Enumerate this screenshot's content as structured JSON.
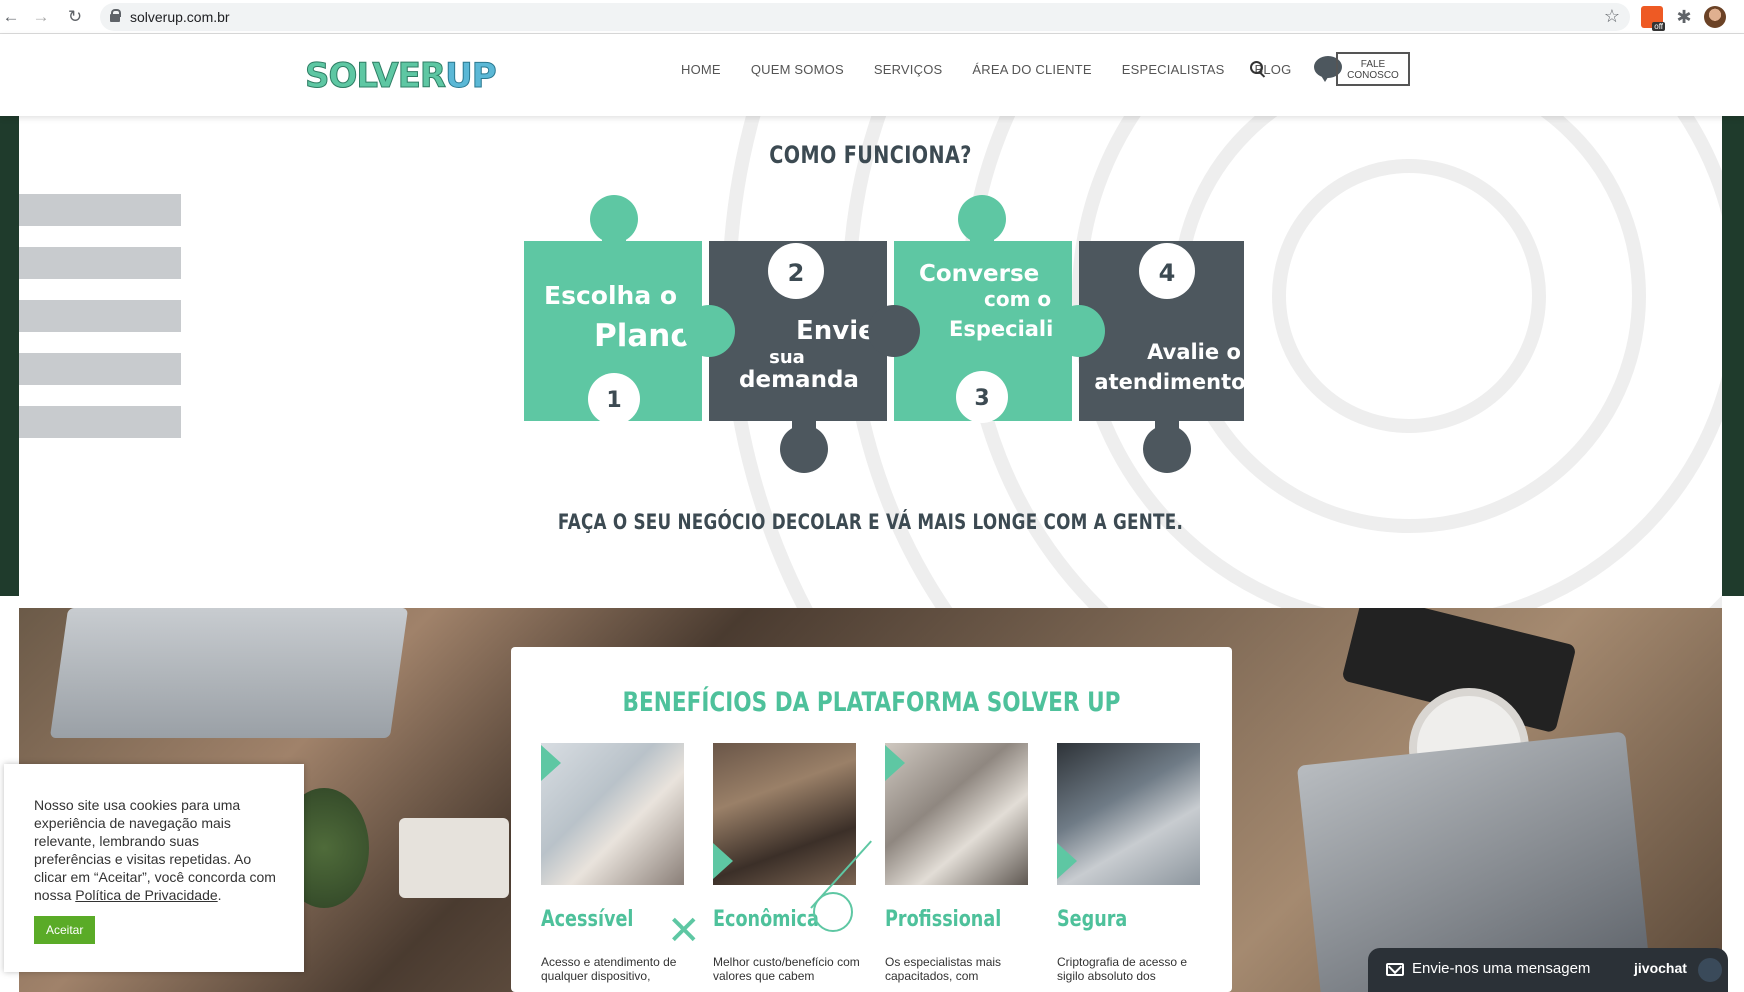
{
  "browser": {
    "url": "solverup.com.br",
    "extension_badge": "off"
  },
  "header": {
    "logo_solver": "SOLVER",
    "logo_up": "UP",
    "menu": [
      "HOME",
      "QUEM SOMOS",
      "SERVIÇOS",
      "ÁREA DO CLIENTE",
      "ESPECIALISTAS",
      "BLOG"
    ],
    "contact_line1": "FALE",
    "contact_line2": "CONOSCO"
  },
  "how": {
    "title": "COMO FUNCIONA?",
    "steps": [
      {
        "number": "1",
        "line1": "Escolha o",
        "line2": "Plano",
        "line3": ""
      },
      {
        "number": "2",
        "line1": "Envie",
        "line2": "sua",
        "line3": "demanda"
      },
      {
        "number": "3",
        "line1": "Converse",
        "line2": "com o",
        "line3": "Especialista"
      },
      {
        "number": "4",
        "line1": "Avalie o",
        "line2": "atendimento",
        "line3": ""
      }
    ],
    "tagline": "FAÇA O SEU NEGÓCIO DECOLAR E VÁ MAIS LONGE COM A GENTE."
  },
  "benefits": {
    "title": "BENEFÍCIOS DA PLATAFORMA SOLVER UP",
    "items": [
      {
        "name": "Acessível",
        "desc": "Acesso e atendimento de qualquer dispositivo,"
      },
      {
        "name": "Econômica",
        "desc": "Melhor custo/benefício com valores que cabem"
      },
      {
        "name": "Profissional",
        "desc": "Os especialistas mais capacitados, com"
      },
      {
        "name": "Segura",
        "desc": "Criptografia de acesso e sigilo absoluto dos"
      }
    ]
  },
  "cookie": {
    "text": "Nosso site usa cookies para uma experiência de navegação mais relevante, lembrando suas preferências e visitas repetidas. Ao clicar em “Aceitar”, você concorda com nossa ",
    "link": "Política de Privacidade",
    "end": ".",
    "button": "Aceitar"
  },
  "chat": {
    "label": "Envie-nos uma mensagem",
    "brand": "jivochat"
  },
  "colors": {
    "teal": "#5ec7a3",
    "dark_puzzle": "#4d575e",
    "heading": "#3c4a52"
  }
}
